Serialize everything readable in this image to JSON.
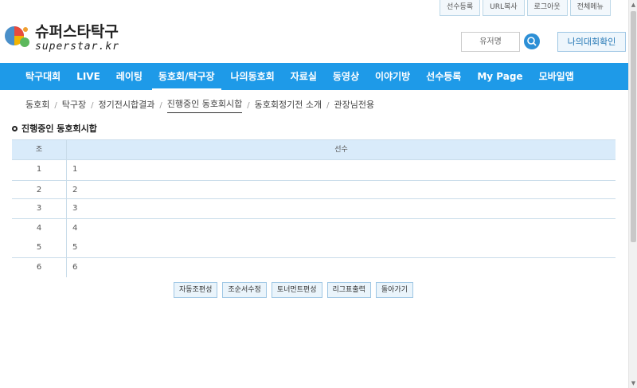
{
  "top_links": [
    "선수등록",
    "URL복사",
    "로그아웃",
    "전체메뉴"
  ],
  "logo": {
    "korean": "슈퍼스타탁구",
    "english": "superstar.kr"
  },
  "header": {
    "search_placeholder": "유저명",
    "my_button": "나의대회확인"
  },
  "nav": [
    "탁구대회",
    "LIVE",
    "레이팅",
    "동호회/탁구장",
    "나의동호회",
    "자료실",
    "동영상",
    "이야기방",
    "선수등록",
    "My Page",
    "모바일앱"
  ],
  "subnav": [
    "동호회",
    "탁구장",
    "정기전시합결과",
    "진행중인 동호회시합",
    "동호회정기전 소개",
    "관장님전용"
  ],
  "section_title": "진행중인 동호회시합",
  "table": {
    "headers": [
      "조",
      "선수"
    ],
    "rows": [
      [
        "1",
        "1"
      ],
      [
        "2",
        "2"
      ],
      [
        "3",
        "3"
      ],
      [
        "4",
        "4"
      ],
      [
        "5",
        "5"
      ],
      [
        "6",
        "6"
      ]
    ]
  },
  "buttons": [
    "자동조편성",
    "조순서수정",
    "토너먼트편성",
    "리그표출력",
    "돌아가기"
  ],
  "colors": {
    "nav_bg": "#1e9ae8",
    "table_header_bg": "#d9ebfa"
  }
}
